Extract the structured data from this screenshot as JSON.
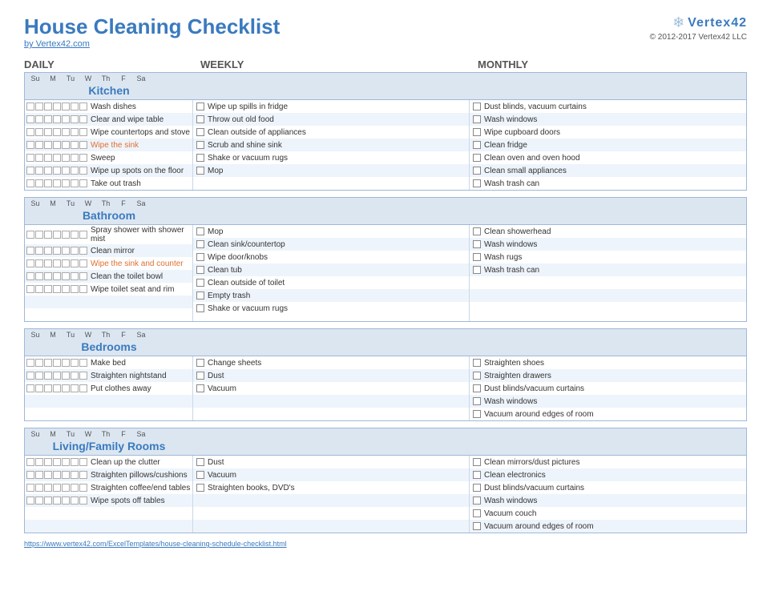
{
  "header": {
    "title": "House Cleaning Checklist",
    "by_link": "by Vertex42.com",
    "logo": "Vertex42",
    "copyright": "© 2012-2017 Vertex42 LLC"
  },
  "columns": {
    "daily": "DAILY",
    "weekly": "WEEKLY",
    "monthly": "MONTHLY"
  },
  "days": [
    "Su",
    "M",
    "Tu",
    "W",
    "Th",
    "F",
    "Sa"
  ],
  "sections": [
    {
      "id": "kitchen",
      "title": "Kitchen",
      "daily": [
        {
          "text": "Wash dishes",
          "style": "normal"
        },
        {
          "text": "Clear and wipe table",
          "style": "normal"
        },
        {
          "text": "Wipe countertops and stove",
          "style": "normal"
        },
        {
          "text": "Wipe the sink",
          "style": "orange"
        },
        {
          "text": "Sweep",
          "style": "normal"
        },
        {
          "text": "Wipe up spots on the floor",
          "style": "normal"
        },
        {
          "text": "Take out trash",
          "style": "normal"
        }
      ],
      "weekly": [
        {
          "text": "Wipe up spills in fridge",
          "style": "normal"
        },
        {
          "text": "Throw out old food",
          "style": "normal"
        },
        {
          "text": "Clean outside of appliances",
          "style": "normal"
        },
        {
          "text": "Scrub and shine sink",
          "style": "normal"
        },
        {
          "text": "Shake or vacuum rugs",
          "style": "normal"
        },
        {
          "text": "Mop",
          "style": "normal"
        }
      ],
      "monthly": [
        {
          "text": "Dust blinds, vacuum curtains",
          "style": "normal"
        },
        {
          "text": "Wash windows",
          "style": "normal"
        },
        {
          "text": "Wipe cupboard doors",
          "style": "normal"
        },
        {
          "text": "Clean fridge",
          "style": "normal"
        },
        {
          "text": "Clean oven and oven hood",
          "style": "normal"
        },
        {
          "text": "Clean small appliances",
          "style": "normal"
        },
        {
          "text": "Wash trash can",
          "style": "normal"
        }
      ]
    },
    {
      "id": "bathroom",
      "title": "Bathroom",
      "daily": [
        {
          "text": "Spray shower with shower mist",
          "style": "normal"
        },
        {
          "text": "Clean mirror",
          "style": "normal"
        },
        {
          "text": "Wipe the sink and counter",
          "style": "orange"
        },
        {
          "text": "Clean the toilet bowl",
          "style": "normal"
        },
        {
          "text": "Wipe toilet seat and rim",
          "style": "normal"
        }
      ],
      "weekly": [
        {
          "text": "Mop",
          "style": "normal"
        },
        {
          "text": "Clean sink/countertop",
          "style": "normal"
        },
        {
          "text": "Wipe door/knobs",
          "style": "normal"
        },
        {
          "text": "Clean tub",
          "style": "normal"
        },
        {
          "text": "Clean outside of toilet",
          "style": "normal"
        },
        {
          "text": "Empty trash",
          "style": "normal"
        },
        {
          "text": "Shake or vacuum rugs",
          "style": "normal"
        }
      ],
      "monthly": [
        {
          "text": "Clean showerhead",
          "style": "normal"
        },
        {
          "text": "Wash windows",
          "style": "normal"
        },
        {
          "text": "Wash rugs",
          "style": "normal"
        },
        {
          "text": "Wash trash can",
          "style": "normal"
        }
      ]
    },
    {
      "id": "bedrooms",
      "title": "Bedrooms",
      "daily": [
        {
          "text": "Make bed",
          "style": "normal"
        },
        {
          "text": "Straighten nightstand",
          "style": "normal"
        },
        {
          "text": "Put clothes away",
          "style": "normal"
        }
      ],
      "weekly": [
        {
          "text": "Change sheets",
          "style": "normal"
        },
        {
          "text": "Dust",
          "style": "normal"
        },
        {
          "text": "Vacuum",
          "style": "normal"
        }
      ],
      "monthly": [
        {
          "text": "Straighten shoes",
          "style": "normal"
        },
        {
          "text": "Straighten drawers",
          "style": "normal"
        },
        {
          "text": "Dust blinds/vacuum curtains",
          "style": "normal"
        },
        {
          "text": "Wash windows",
          "style": "normal"
        },
        {
          "text": "Vacuum around edges of room",
          "style": "normal"
        }
      ]
    },
    {
      "id": "living",
      "title": "Living/Family Rooms",
      "daily": [
        {
          "text": "Clean up the clutter",
          "style": "normal"
        },
        {
          "text": "Straighten pillows/cushions",
          "style": "normal"
        },
        {
          "text": "Straighten coffee/end tables",
          "style": "normal"
        },
        {
          "text": "Wipe spots off tables",
          "style": "normal"
        }
      ],
      "weekly": [
        {
          "text": "Dust",
          "style": "normal"
        },
        {
          "text": "Vacuum",
          "style": "normal"
        },
        {
          "text": "Straighten books, DVD's",
          "style": "normal"
        }
      ],
      "monthly": [
        {
          "text": "Clean mirrors/dust pictures",
          "style": "normal"
        },
        {
          "text": "Clean electronics",
          "style": "normal"
        },
        {
          "text": "Dust blinds/vacuum curtains",
          "style": "normal"
        },
        {
          "text": "Wash windows",
          "style": "normal"
        },
        {
          "text": "Vacuum couch",
          "style": "normal"
        },
        {
          "text": "Vacuum around edges of room",
          "style": "normal"
        }
      ]
    }
  ],
  "footer_url": "https://www.vertex42.com/ExcelTemplates/house-cleaning-schedule-checklist.html"
}
